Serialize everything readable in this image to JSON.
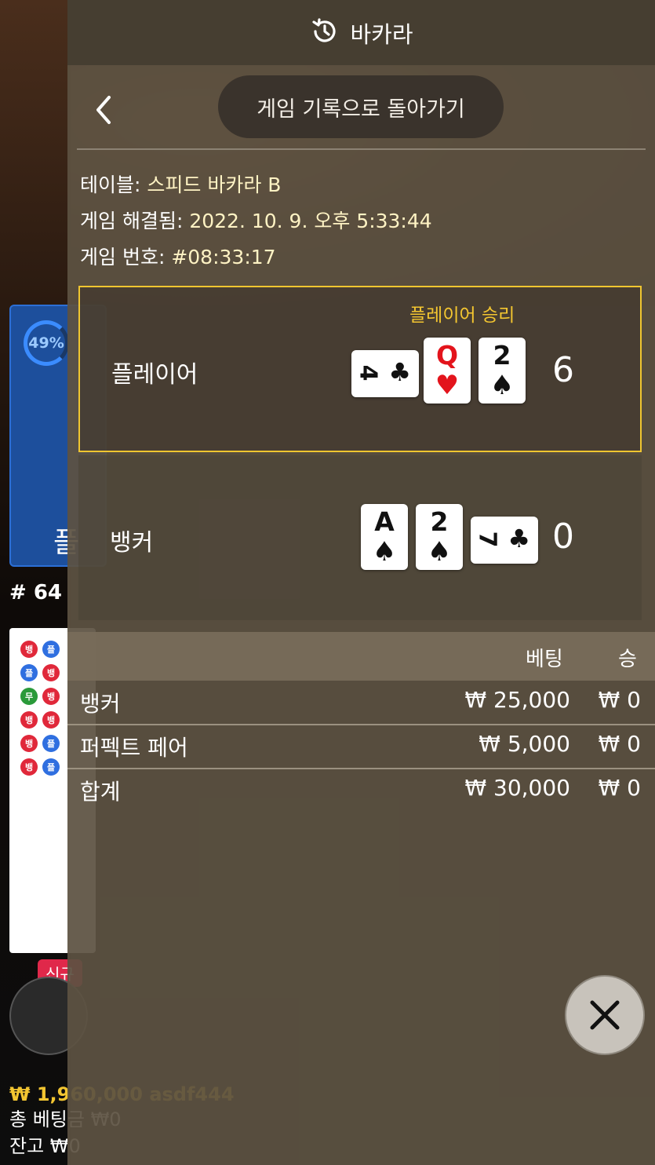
{
  "background": {
    "percent": "49%",
    "player_label": "플",
    "round_label": "# 64",
    "new_badge": "신규",
    "footer_balance_top": "₩ 1,960,000 asdf444",
    "footer_total_bet": "총 베팅금 ₩0",
    "footer_balance": "잔고 ₩0",
    "road_chips": [
      {
        "t": "뱅",
        "c": "#e0283a"
      },
      {
        "t": "플",
        "c": "#2f6fe0"
      },
      {
        "t": "플",
        "c": "#2f6fe0"
      },
      {
        "t": "뱅",
        "c": "#e0283a"
      },
      {
        "t": "무",
        "c": "#2a9a3a"
      },
      {
        "t": "뱅",
        "c": "#e0283a"
      },
      {
        "t": "뱅",
        "c": "#e0283a"
      },
      {
        "t": "뱅",
        "c": "#e0283a"
      },
      {
        "t": "뱅",
        "c": "#e0283a"
      },
      {
        "t": "플",
        "c": "#2f6fe0"
      },
      {
        "t": "뱅",
        "c": "#e0283a"
      },
      {
        "t": "플",
        "c": "#2f6fe0"
      }
    ]
  },
  "header": {
    "title": "바카라",
    "icon": "history-icon"
  },
  "nav": {
    "back_history_label": "게임 기록으로 돌아가기"
  },
  "info": {
    "table_label": "테이블:",
    "table_value": "스피드 바카라 B",
    "resolved_label": "게임 해결됨:",
    "resolved_value": "2022. 10. 9. 오후 5:33:44",
    "game_no_label": "게임 번호:",
    "game_no_value": "#08:33:17"
  },
  "player": {
    "label": "플레이어",
    "win_text": "플레이어 승리",
    "score": "6",
    "cards": [
      {
        "rank": "4",
        "suit": "♣",
        "color": "black",
        "side": true
      },
      {
        "rank": "Q",
        "suit": "♥",
        "color": "red",
        "side": false
      },
      {
        "rank": "2",
        "suit": "♠",
        "color": "black",
        "side": false
      }
    ]
  },
  "banker": {
    "label": "뱅커",
    "score": "0",
    "cards": [
      {
        "rank": "A",
        "suit": "♠",
        "color": "black",
        "side": false
      },
      {
        "rank": "2",
        "suit": "♠",
        "color": "black",
        "side": false
      },
      {
        "rank": "7",
        "suit": "♣",
        "color": "black",
        "side": true
      }
    ]
  },
  "bets": {
    "col_bet": "베팅",
    "col_win": "승",
    "rows": [
      {
        "name": "뱅커",
        "bet": "₩ 25,000",
        "win": "₩ 0"
      },
      {
        "name": "퍼펙트 페어",
        "bet": "₩ 5,000",
        "win": "₩ 0"
      },
      {
        "name": "합계",
        "bet": "₩ 30,000",
        "win": "₩ 0"
      }
    ]
  },
  "colors": {
    "accent": "#f0c630",
    "win_text": "#f4c630"
  }
}
